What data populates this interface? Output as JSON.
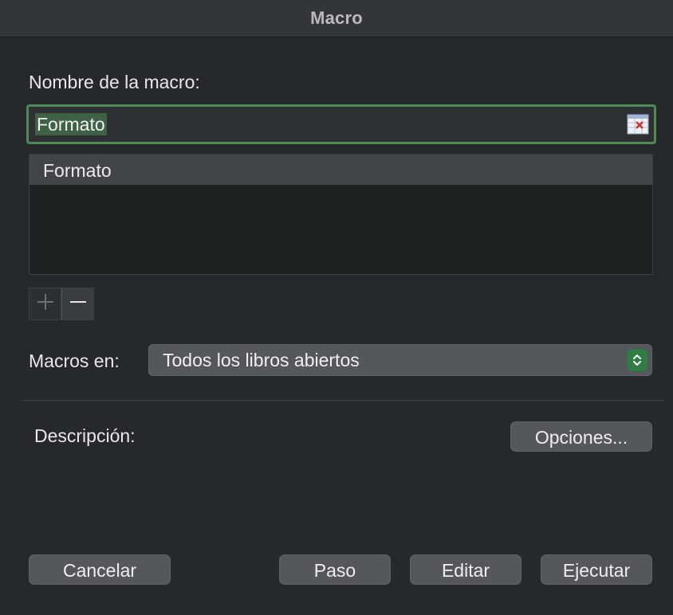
{
  "window": {
    "title": "Macro"
  },
  "name_section": {
    "label": "Nombre de la macro:",
    "value": "Formato"
  },
  "macro_list": {
    "items": [
      "Formato"
    ]
  },
  "list_controls": {
    "add_icon": "plus-icon",
    "remove_icon": "minus-icon"
  },
  "macros_in": {
    "label": "Macros en:",
    "selected": "Todos los libros abiertos"
  },
  "description": {
    "label": "Descripción:"
  },
  "buttons": {
    "options": "Opciones...",
    "cancel": "Cancelar",
    "step": "Paso",
    "edit": "Editar",
    "run": "Ejecutar"
  },
  "colors": {
    "background": "#26292b",
    "focus_ring": "#4d8a57",
    "stepper_accent": "#2f7d43",
    "button_fill": "#55585b"
  }
}
